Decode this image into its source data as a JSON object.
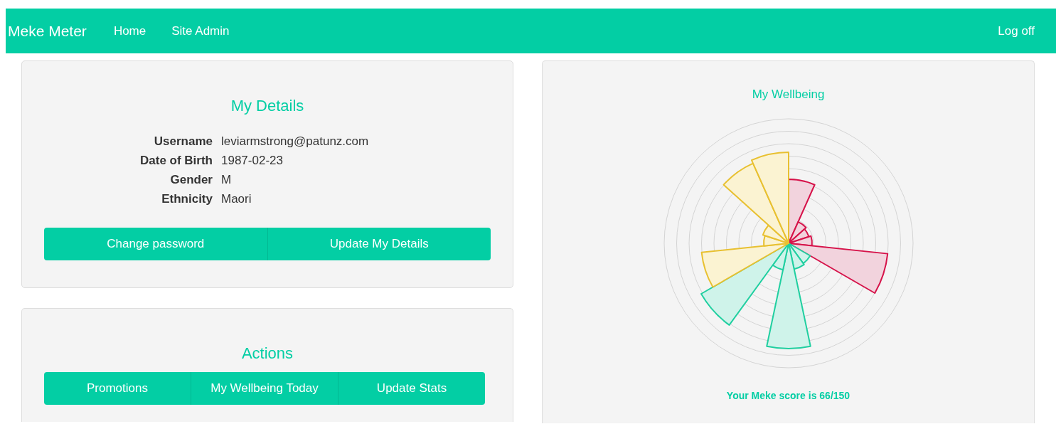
{
  "navbar": {
    "brand": "Meke Meter",
    "links": [
      "Home",
      "Site Admin"
    ],
    "logoff": "Log off"
  },
  "details": {
    "title": "My Details",
    "fields": [
      {
        "label": "Username",
        "value": "leviarmstrong@patunz.com"
      },
      {
        "label": "Date of Birth",
        "value": "1987-02-23"
      },
      {
        "label": "Gender",
        "value": "M"
      },
      {
        "label": "Ethnicity",
        "value": "Maori"
      }
    ],
    "buttons": [
      "Change password",
      "Update My Details"
    ]
  },
  "actions": {
    "title": "Actions",
    "buttons": [
      "Promotions",
      "My Wellbeing Today",
      "Update Stats"
    ]
  },
  "wellbeing": {
    "title": "My Wellbeing",
    "score_text": "Your Meke score is 66/150"
  }
}
